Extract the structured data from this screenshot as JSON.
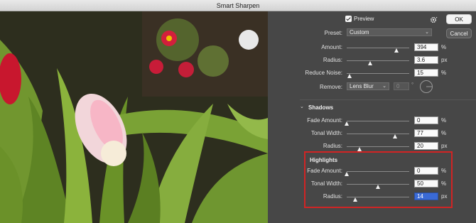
{
  "window": {
    "title": "Smart Sharpen"
  },
  "colors": {
    "panel_bg": "#474747",
    "highlight_border": "#d12424",
    "selected_field": "#3a6ad6"
  },
  "toolbar": {
    "preview_label": "Preview",
    "preview_checked": true,
    "ok_label": "OK",
    "cancel_label": "Cancel",
    "settings_icon": "gear-icon"
  },
  "preset": {
    "label": "Preset:",
    "value": "Custom"
  },
  "main": {
    "amount": {
      "label": "Amount:",
      "value": "394",
      "unit": "%",
      "level": 0.79
    },
    "radius": {
      "label": "Radius:",
      "value": "3.6",
      "unit": "px",
      "level": 0.38
    },
    "reduce_noise": {
      "label": "Reduce Noise:",
      "value": "15",
      "unit": "%",
      "level": 0.05
    },
    "remove": {
      "label": "Remove:",
      "value": "Lens Blur",
      "angle": "0",
      "angle_unit": "°",
      "angle_icon": "angle-dial-icon"
    }
  },
  "shadows": {
    "title": "Shadows",
    "fade_amount": {
      "label": "Fade Amount:",
      "value": "0",
      "unit": "%",
      "level": 0.0
    },
    "tonal_width": {
      "label": "Tonal Width:",
      "value": "77",
      "unit": "%",
      "level": 0.77
    },
    "radius": {
      "label": "Radius:",
      "value": "20",
      "unit": "px",
      "level": 0.2
    }
  },
  "highlights": {
    "title": "Highlights",
    "fade_amount": {
      "label": "Fade Amount:",
      "value": "0",
      "unit": "%",
      "level": 0.0
    },
    "tonal_width": {
      "label": "Tonal Width:",
      "value": "50",
      "unit": "%",
      "level": 0.5
    },
    "radius": {
      "label": "Radius:",
      "value": "14",
      "unit": "px",
      "level": 0.14
    }
  }
}
